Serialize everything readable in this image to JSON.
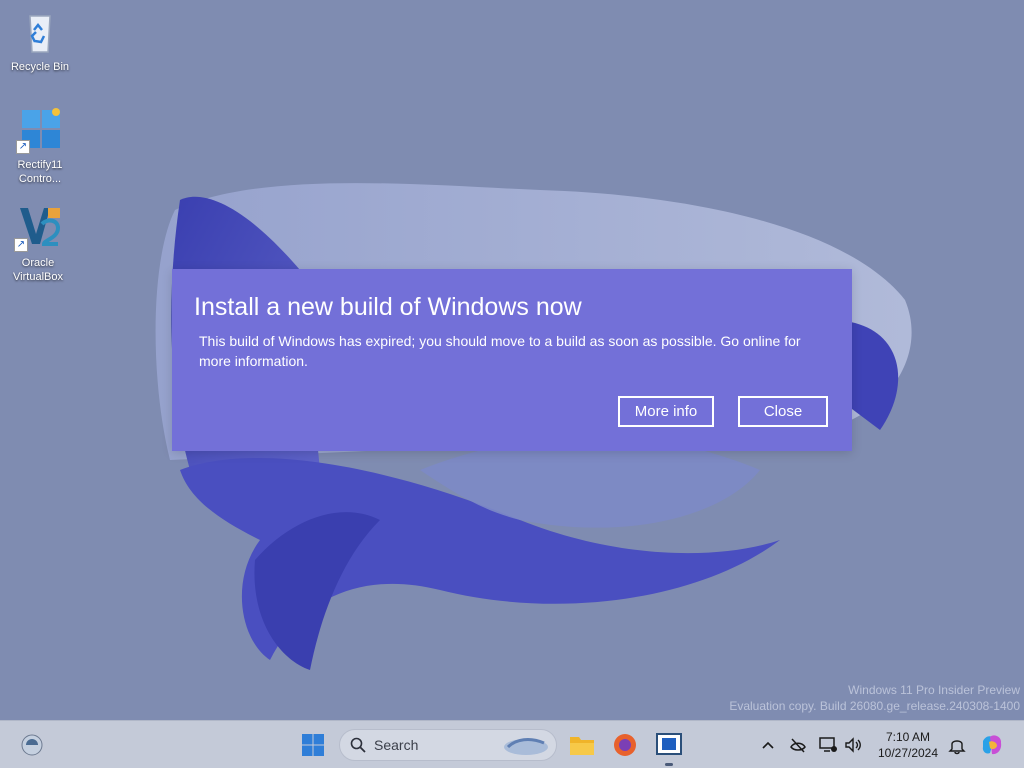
{
  "desktop": {
    "icons": [
      {
        "label": "Recycle Bin",
        "icon": "recycle-bin-icon"
      },
      {
        "label": "Rectify11 Contro...",
        "icon": "control-center-icon"
      },
      {
        "label": "Oracle VirtualBox",
        "icon": "virtualbox-icon"
      }
    ],
    "watermark": {
      "line1": "Windows 11 Pro Insider Preview",
      "line2": "Evaluation copy. Build 26080.ge_release.240308-1400"
    }
  },
  "dialog": {
    "title": "Install a new build of Windows now",
    "body": "This build of Windows has expired; you should move to a build as soon as possible. Go online for more information.",
    "more_info_label": "More info",
    "close_label": "Close",
    "background_color": "#7370d8"
  },
  "taskbar": {
    "search_label": "Search",
    "pinned": [
      "widgets-icon",
      "start-icon",
      "file-explorer-icon",
      "firefox-icon",
      "virtual-machine-app-icon"
    ],
    "tray": {
      "time": "7:10 AM",
      "date": "10/27/2024",
      "icons": [
        "chevron-up-icon",
        "network-offline-icon",
        "display-icon",
        "volume-icon",
        "notification-bell-icon",
        "copilot-icon"
      ]
    }
  }
}
